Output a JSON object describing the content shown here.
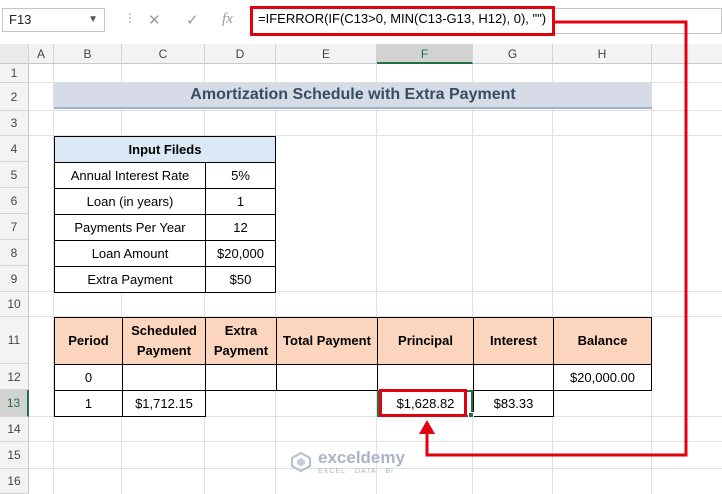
{
  "formula_bar": {
    "name_box": "F13",
    "formula": "=IFERROR(IF(C13>0, MIN(C13-G13, H12), 0), \"\")",
    "cancel_glyph": "✕",
    "enter_glyph": "✓",
    "fx_glyph": "fx"
  },
  "columns": [
    "A",
    "B",
    "C",
    "D",
    "E",
    "F",
    "G",
    "H"
  ],
  "rows": [
    "1",
    "2",
    "3",
    "4",
    "5",
    "6",
    "7",
    "8",
    "9",
    "10",
    "11",
    "12",
    "13",
    "14",
    "15",
    "16"
  ],
  "selected": {
    "column": "F",
    "row": "13"
  },
  "title": "Amortization Schedule with Extra Payment",
  "inputs": {
    "header": "Input Fileds",
    "items": [
      {
        "label": "Annual Interest Rate",
        "value": "5%"
      },
      {
        "label": "Loan (in years)",
        "value": "1"
      },
      {
        "label": "Payments Per Year",
        "value": "12"
      },
      {
        "label": "Loan Amount",
        "value": "$20,000"
      },
      {
        "label": "Extra Payment",
        "value": "$50"
      }
    ]
  },
  "schedule": {
    "headers": [
      "Period",
      "Scheduled Payment",
      "Extra Payment",
      "Total Payment",
      "Principal",
      "Interest",
      "Balance"
    ],
    "rows": [
      [
        "0",
        "",
        "",
        "",
        "",
        "",
        "$20,000.00"
      ],
      [
        "1",
        "$1,712.15",
        "",
        "",
        "$1,628.82",
        "$83.33",
        ""
      ]
    ]
  },
  "watermark": {
    "name": "exceldemy",
    "tagline": "EXCEL · DATA · BI"
  },
  "colors": {
    "accent_red": "#e3000f",
    "excel_green": "#217346",
    "header_fill": "#fbd5bd",
    "input_header_fill": "#dbe9f7",
    "title_fill": "#d6dce5"
  }
}
